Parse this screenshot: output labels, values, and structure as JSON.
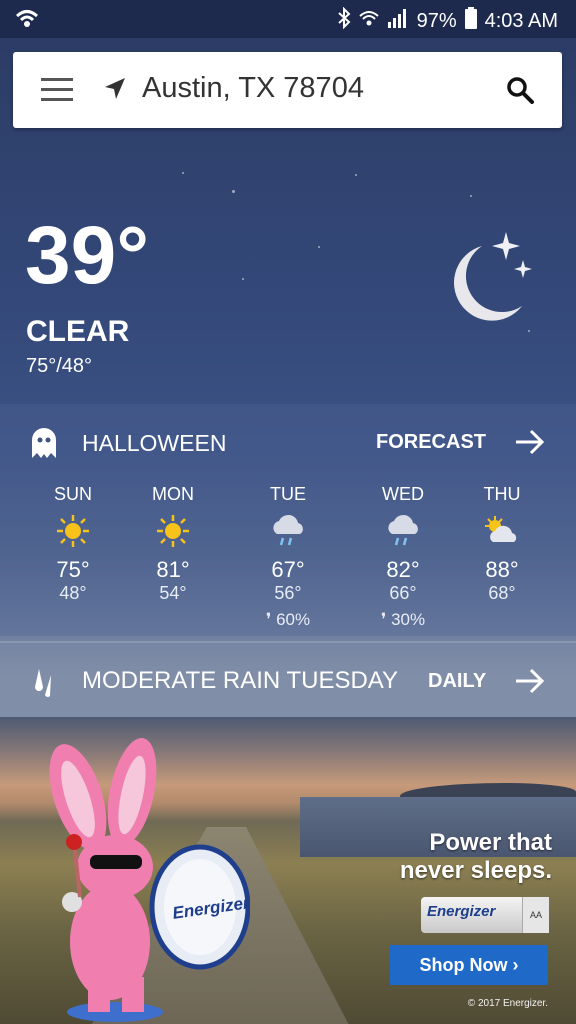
{
  "status_bar": {
    "battery": "97%",
    "time": "4:03 AM"
  },
  "search": {
    "location": "Austin, TX 78704"
  },
  "current": {
    "temp": "39°",
    "condition": "CLEAR",
    "hilo": "75°/48°"
  },
  "forecast": {
    "title": "HALLOWEEN",
    "link_label": "FORECAST",
    "days": [
      {
        "name": "SUN",
        "icon": "sun-icon",
        "hi": "75°",
        "lo": "48°",
        "precip": ""
      },
      {
        "name": "MON",
        "icon": "sun-icon",
        "hi": "81°",
        "lo": "54°",
        "precip": ""
      },
      {
        "name": "TUE",
        "icon": "rain-cloud-icon",
        "hi": "67°",
        "lo": "56°",
        "precip": "60%"
      },
      {
        "name": "WED",
        "icon": "rain-cloud-icon",
        "hi": "82°",
        "lo": "66°",
        "precip": "30%"
      },
      {
        "name": "THU",
        "icon": "partly-cloudy-icon",
        "hi": "88°",
        "lo": "68°",
        "precip": ""
      }
    ]
  },
  "alert_bar": {
    "text": "MODERATE RAIN TUESDAY",
    "link_label": "DAILY"
  },
  "ad": {
    "tagline_line1": "Power that",
    "tagline_line2": "never sleeps.",
    "brand": "Energizer",
    "battery_size": "AA",
    "button_label": "Shop Now ›",
    "copyright": "© 2017 Energizer."
  },
  "colors": {
    "ad_button": "#1f69c9",
    "sun": "#f7c21a",
    "rain": "#7fc3f0"
  }
}
